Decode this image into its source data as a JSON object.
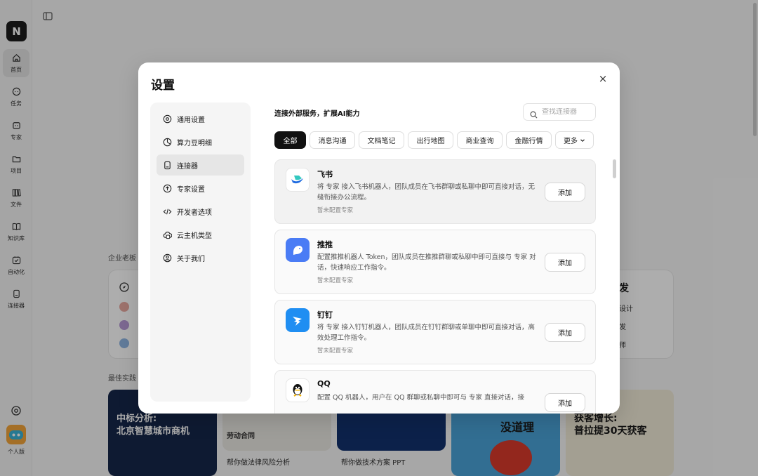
{
  "rail": {
    "logo": "N",
    "items": [
      {
        "label": "首页",
        "icon": "home-icon"
      },
      {
        "label": "任务",
        "icon": "chat-icon"
      },
      {
        "label": "专家",
        "icon": "expert-icon"
      },
      {
        "label": "项目",
        "icon": "folder-icon"
      },
      {
        "label": "文件",
        "icon": "files-icon"
      },
      {
        "label": "知识库",
        "icon": "book-icon"
      },
      {
        "label": "自动化",
        "icon": "automation-icon"
      },
      {
        "label": "连接器",
        "icon": "connector-icon"
      }
    ],
    "avatar_label": "个人版"
  },
  "background": {
    "section_enterprise": "企业老板",
    "right_card_title": "发",
    "right_items": [
      "设计",
      "发",
      "师"
    ],
    "section_best": "最佳实践",
    "gallery": [
      {
        "title_line1": "中标分析:",
        "title_line2": "北京智慧城市商机",
        "caption": ""
      },
      {
        "title_line1": "劳动合同",
        "title_line2": "",
        "caption": "帮你做法律风险分析"
      },
      {
        "title_line1": "",
        "title_line2": "",
        "caption": "帮你做技术方案 PPT"
      },
      {
        "title_line1": "没道理",
        "title_line2": "",
        "caption": ""
      },
      {
        "title_line1": "获客增长:",
        "title_line2": "普拉提30天获客",
        "caption": ""
      }
    ]
  },
  "modal": {
    "title": "设置",
    "close": "×",
    "menu": [
      {
        "label": "通用设置",
        "icon": "gear-icon",
        "active": false
      },
      {
        "label": "算力豆明细",
        "icon": "pie-icon",
        "active": false
      },
      {
        "label": "连接器",
        "icon": "connector-icon",
        "active": true
      },
      {
        "label": "专家设置",
        "icon": "cloud-upload-icon",
        "active": false
      },
      {
        "label": "开发者选项",
        "icon": "code-icon",
        "active": false
      },
      {
        "label": "云主机类型",
        "icon": "cloud-host-icon",
        "active": false
      },
      {
        "label": "关于我们",
        "icon": "user-circle-icon",
        "active": false
      }
    ],
    "heading": "连接外部服务，扩展AI能力",
    "search_placeholder": "查找连接器",
    "filters": [
      "全部",
      "消息沟通",
      "文档笔记",
      "出行地图",
      "商业查询",
      "金融行情",
      "更多"
    ],
    "active_filter": "全部",
    "connectors": [
      {
        "name": "飞书",
        "desc": "将 专家 接入飞书机器人，团队成员在飞书群聊或私聊中即可直接对话，无缝衔接办公流程。",
        "status": "暂未配置专家",
        "button": "添加",
        "logo": "feishu-logo",
        "color": "#ffffff"
      },
      {
        "name": "推推",
        "desc": "配置推推机器人 Token，团队成员在推推群聊或私聊中即可直接与 专家 对话，快速响应工作指令。",
        "status": "暂未配置专家",
        "button": "添加",
        "logo": "tuitui-logo",
        "color": "#4a7cf5"
      },
      {
        "name": "钉钉",
        "desc": "将 专家 接入钉钉机器人，团队成员在钉钉群聊或单聊中即可直接对话，高效处理工作指令。",
        "status": "暂未配置专家",
        "button": "添加",
        "logo": "dingtalk-logo",
        "color": "#1f8ef2"
      },
      {
        "name": "QQ",
        "desc": "配置 QQ 机器人，用户在 QQ 群聊或私聊中即可与 专家 直接对话，接",
        "status": "",
        "button": "添加",
        "logo": "qq-logo",
        "color": "#ffffff"
      }
    ]
  }
}
